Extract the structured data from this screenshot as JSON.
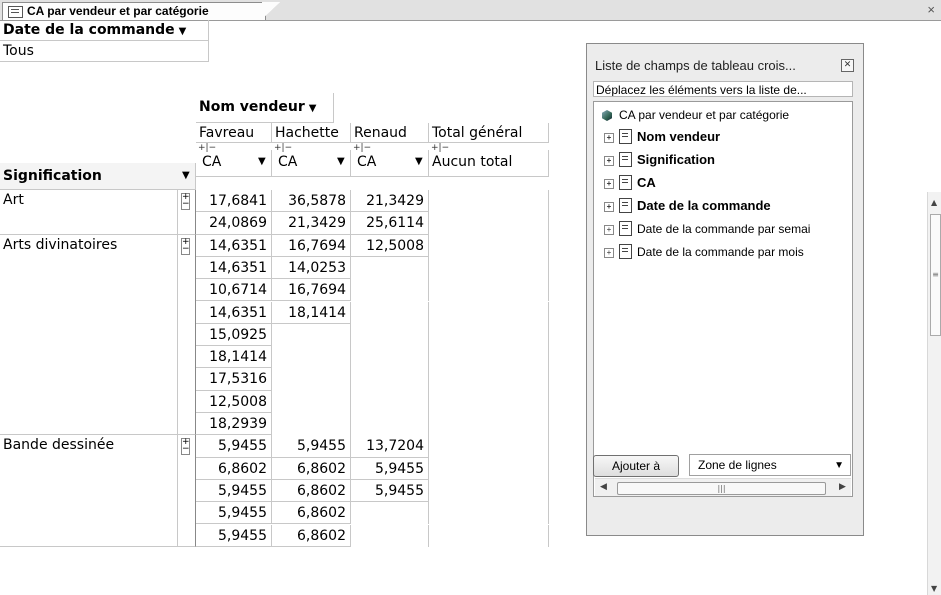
{
  "tab": {
    "title": "CA par vendeur et par catégorie",
    "close": "×"
  },
  "filter": {
    "field": "Date de la commande",
    "value": "Tous"
  },
  "pivot": {
    "column_field": "Nom vendeur",
    "columns": [
      "Favreau",
      "Hachette",
      "Renaud",
      "Total général"
    ],
    "row_field": "Signification",
    "data_label": "CA",
    "total_label": "Aucun total",
    "groups": [
      {
        "name": "Art",
        "rows": [
          [
            "17,6841",
            "36,5878",
            "21,3429"
          ],
          [
            "24,0869",
            "21,3429",
            "25,6114"
          ]
        ]
      },
      {
        "name": "Arts divinatoires",
        "rows": [
          [
            "14,6351",
            "16,7694",
            "12,5008"
          ],
          [
            "14,6351",
            "14,0253",
            ""
          ],
          [
            "10,6714",
            "16,7694",
            ""
          ],
          [
            "14,6351",
            "18,1414",
            ""
          ],
          [
            "15,0925",
            "",
            ""
          ],
          [
            "18,1414",
            "",
            ""
          ],
          [
            "17,5316",
            "",
            ""
          ],
          [
            "12,5008",
            "",
            ""
          ],
          [
            "18,2939",
            "",
            ""
          ]
        ]
      },
      {
        "name": "Bande dessinée",
        "rows": [
          [
            "5,9455",
            "5,9455",
            "13,7204"
          ],
          [
            "6,8602",
            "6,8602",
            "5,9455"
          ],
          [
            "5,9455",
            "6,8602",
            "5,9455"
          ],
          [
            "5,9455",
            "6,8602",
            ""
          ],
          [
            "5,9455",
            "6,8602",
            ""
          ]
        ]
      }
    ]
  },
  "field_list": {
    "title": "Liste de champs de tableau crois...",
    "subtitle": "Déplacez les éléments vers la liste de...",
    "root": "CA par vendeur et par catégorie",
    "items": [
      {
        "label": "Nom vendeur",
        "bold": true
      },
      {
        "label": "Signification",
        "bold": true
      },
      {
        "label": "CA",
        "bold": true
      },
      {
        "label": "Date de la commande",
        "bold": true
      },
      {
        "label": "Date de la commande par semai",
        "bold": false
      },
      {
        "label": "Date de la commande par mois",
        "bold": false
      }
    ],
    "add_button": "Ajouter à",
    "zone_value": "Zone de lignes"
  }
}
